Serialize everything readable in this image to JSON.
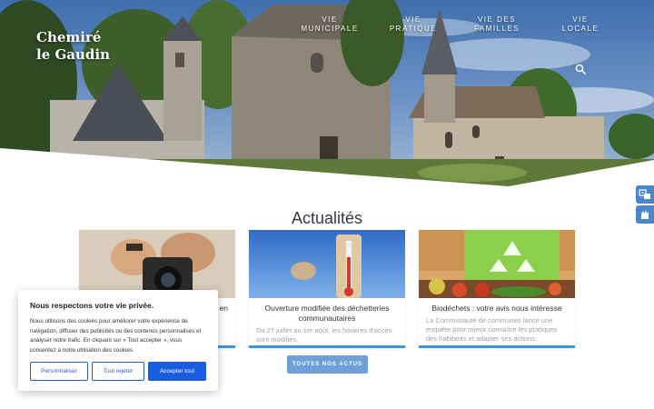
{
  "site": {
    "logo_line1": "Chemiré",
    "logo_line2": "le Gaudin"
  },
  "nav": [
    {
      "line1": "VIE",
      "line2": "MUNICIPALE"
    },
    {
      "line1": "VIE",
      "line2": "PRATIQUE"
    },
    {
      "line1": "VIE DES",
      "line2": "FAMILLES"
    },
    {
      "line1": "VIE",
      "line2": "LOCALE"
    }
  ],
  "icons": {
    "search": "search-icon",
    "side_top": "translate-icon",
    "side_bottom": "sign-language-icon"
  },
  "news": {
    "section_title": "Actualités",
    "cards": [
      {
        "title": "Nouvelle saison de photos en",
        "title_visible_fragment": "en",
        "description": "",
        "image": "photographer-camera"
      },
      {
        "title": "Ouverture modifiée des déchetteries communautaires",
        "description": "Du 27 juillet au 1er août, les horaires d'accès sont modifiés.",
        "image": "thermometer-heat"
      },
      {
        "title": "Biodéchets : votre avis nous intéresse",
        "description": "La Communauté de communes lance une enquête pour mieux connaître les pratiques des habitants et adapter ses actions.",
        "image": "compost-bin-vegetables"
      }
    ],
    "all_news_label": "TOUTES NOS ACTUS"
  },
  "cookie": {
    "title": "Nous respectons votre vie privée.",
    "text": "Nous utilisons des cookies pour améliorer votre expérience de navigation, diffuser des publicités ou des contenus personnalisés et analyser notre trafic. En cliquant sur « Tout accepter », vous consentez à notre utilisation des cookies.",
    "customize_label": "Personnaliser",
    "reject_label": "Tout rejeter",
    "accept_label": "Accepter tout"
  },
  "colors": {
    "accent": "#3b95d6",
    "button": "#6fa0d8",
    "cookie_primary": "#1a5ce0"
  }
}
